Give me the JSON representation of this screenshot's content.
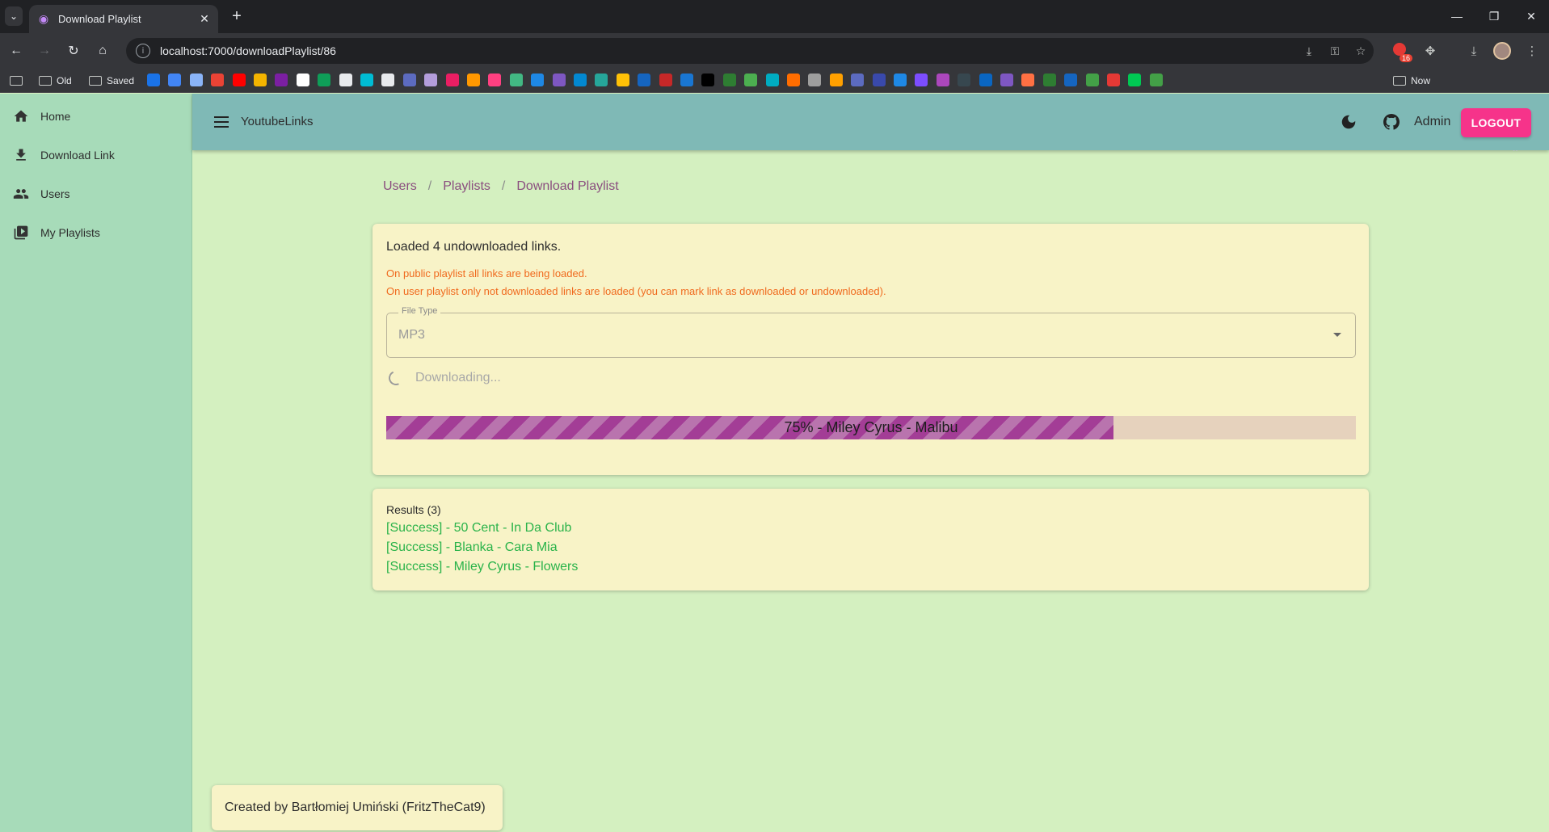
{
  "browser": {
    "tab_title": "Download Playlist",
    "url": "localhost:7000/downloadPlaylist/86",
    "extension_badge": "16",
    "bookmarks": [
      {
        "label": "Old"
      },
      {
        "label": "Saved"
      },
      {
        "label": "Now"
      }
    ]
  },
  "sidebar": {
    "items": [
      {
        "label": "Home",
        "icon": "home-icon"
      },
      {
        "label": "Download Link",
        "icon": "download-icon"
      },
      {
        "label": "Users",
        "icon": "users-icon"
      },
      {
        "label": "My Playlists",
        "icon": "playlist-icon"
      }
    ]
  },
  "appbar": {
    "title": "YoutubeLinks",
    "user": "Admin",
    "logout_label": "LOGOUT"
  },
  "breadcrumb": [
    "Users",
    "Playlists",
    "Download Playlist"
  ],
  "download": {
    "loaded_text": "Loaded 4 undownloaded links.",
    "warning_1": "On public playlist all links are being loaded.",
    "warning_2": "On user playlist only not downloaded links are loaded (you can mark link as downloaded or undownloaded).",
    "file_type_label": "File Type",
    "file_type_value": "MP3",
    "status_text": "Downloading...",
    "progress_fraction": 0.75,
    "progress_label": "75% - Miley Cyrus - Malibu"
  },
  "results": {
    "title": "Results (3)",
    "items": [
      "[Success] - 50 Cent - In Da Club",
      "[Success] - Blanka - Cara Mia",
      "[Success] - Miley Cyrus - Flowers"
    ]
  },
  "footer": {
    "text": "Created by Bartłomiej Umiński (FritzTheCat9)"
  },
  "colors": {
    "sidebar_bg": "#a7dbb9",
    "appbar_bg": "#7fb9b6",
    "page_bg": "#d4f0c0",
    "card_bg": "#f8f3c7",
    "logout_bg": "#f6338a",
    "progress_fill": "#a33d96",
    "success": "#2ab34a",
    "warning": "#f06a1e"
  }
}
